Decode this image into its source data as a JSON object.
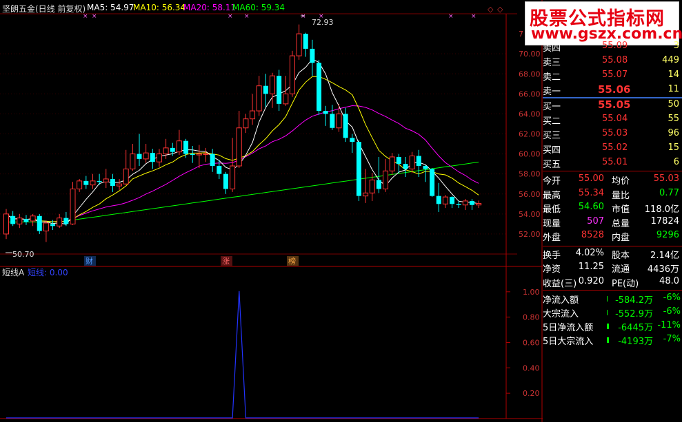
{
  "header": {
    "stock_title": "坚朗五金(日线 前复权)",
    "ma5_label": "MA5: 54.97",
    "ma10_label": "MA10: 56.34",
    "ma20_label": "MA20: 58.11",
    "ma60_label": "MA60: 59.34",
    "colors": {
      "ma5": "#ffffff",
      "ma10": "#ffff00",
      "ma20": "#ff00ff",
      "ma60": "#00ff00",
      "up": "#ff3333",
      "down": "#00ffff"
    }
  },
  "indicator": {
    "name": "短线A",
    "value_label": "短线: 0.00",
    "ticks": [
      "1.00",
      "0.80",
      "0.60",
      "0.40",
      "0.20"
    ]
  },
  "price_axis": [
    "70.00",
    "68.00",
    "66.00",
    "64.00",
    "62.00",
    "60.00",
    "58.00",
    "56.00",
    "54.00",
    "52.00"
  ],
  "price_axis_top": "7",
  "annotations": {
    "high_price": "72.93",
    "low_price": "50.70",
    "events": [
      "财",
      "涨",
      "榜"
    ]
  },
  "logo": {
    "main": "股票公式指标网",
    "url": "www.gszx.com.cn"
  },
  "orderbook": {
    "asks": [
      {
        "label": "卖四",
        "price": "55.09",
        "vol": "3"
      },
      {
        "label": "卖三",
        "price": "55.08",
        "vol": "449"
      },
      {
        "label": "卖二",
        "price": "55.07",
        "vol": "14"
      },
      {
        "label": "卖一",
        "price": "55.06",
        "vol": "11"
      }
    ],
    "bids": [
      {
        "label": "买一",
        "price": "55.05",
        "vol": "50"
      },
      {
        "label": "买二",
        "price": "55.04",
        "vol": "55"
      },
      {
        "label": "买三",
        "price": "55.03",
        "vol": "96"
      },
      {
        "label": "买四",
        "price": "55.02",
        "vol": "15"
      },
      {
        "label": "买五",
        "price": "55.01",
        "vol": "6"
      }
    ]
  },
  "quote": [
    {
      "l1": "今开",
      "v1": "55.00",
      "c1": "#ff3333",
      "l2": "均价",
      "v2": "55.03",
      "c2": "#ff3333"
    },
    {
      "l1": "最高",
      "v1": "55.34",
      "c1": "#ff3333",
      "l2": "量比",
      "v2": "0.77",
      "c2": "#00ff00"
    },
    {
      "l1": "最低",
      "v1": "54.60",
      "c1": "#00ff00",
      "l2": "市值",
      "v2": "118.0亿",
      "c2": "#ffffff"
    },
    {
      "l1": "现量",
      "v1": "507",
      "c1": "#ff33ff",
      "l2": "总量",
      "v2": "17824",
      "c2": "#ffffff"
    },
    {
      "l1": "外盘",
      "v1": "8528",
      "c1": "#ff3333",
      "l2": "内盘",
      "v2": "9296",
      "c2": "#00ff00"
    }
  ],
  "fundamentals": [
    {
      "l1": "换手",
      "v1": "4.02%",
      "l2": "股本",
      "v2": "2.14亿"
    },
    {
      "l1": "净资",
      "v1": "11.25",
      "l2": "流通",
      "v2": "4436万"
    },
    {
      "l1": "收益(三)",
      "v1": "0.920",
      "l2": "PE(动)",
      "v2": "48.0"
    }
  ],
  "flows": [
    {
      "label": "净流入额",
      "value": "-584.2万",
      "pct": "-6%"
    },
    {
      "label": "大宗流入",
      "value": "-552.9万",
      "pct": "-6%"
    },
    {
      "label": "5日净流入额",
      "value": "-6445万",
      "pct": "-11%"
    },
    {
      "label": "5日大宗流入",
      "value": "-4193万",
      "pct": "-7%"
    }
  ],
  "chart_data": {
    "type": "candlestick",
    "ylim": [
      50.0,
      74.0
    ],
    "candles": [
      [
        52.0,
        54.0,
        51.5,
        54.5
      ],
      [
        53.8,
        53.0,
        52.8,
        54.3
      ],
      [
        53.0,
        53.6,
        52.6,
        54.0
      ],
      [
        53.5,
        53.2,
        52.9,
        53.9
      ],
      [
        53.3,
        53.8,
        52.8,
        54.0
      ],
      [
        53.8,
        52.3,
        52.0,
        54.0
      ],
      [
        52.3,
        53.1,
        51.2,
        53.3
      ],
      [
        53.0,
        52.8,
        52.4,
        53.4
      ],
      [
        52.8,
        53.6,
        52.6,
        54.0
      ],
      [
        53.6,
        53.0,
        52.8,
        54.2
      ],
      [
        53.0,
        56.5,
        52.9,
        57.2
      ],
      [
        56.5,
        57.3,
        56.2,
        57.5
      ],
      [
        57.3,
        56.9,
        56.5,
        57.8
      ],
      [
        56.9,
        57.3,
        56.5,
        58.0
      ],
      [
        57.3,
        57.2,
        56.9,
        58.0
      ],
      [
        57.2,
        57.5,
        56.6,
        58.5
      ],
      [
        57.5,
        56.8,
        56.2,
        58.0
      ],
      [
        56.8,
        57.0,
        56.4,
        57.5
      ],
      [
        57.0,
        58.5,
        56.9,
        60.4
      ],
      [
        58.5,
        60.0,
        58.3,
        61.0
      ],
      [
        60.0,
        59.5,
        58.8,
        62.0
      ],
      [
        59.5,
        60.1,
        59.1,
        61.0
      ],
      [
        60.1,
        59.2,
        58.5,
        60.5
      ],
      [
        59.2,
        60.0,
        58.7,
        60.5
      ],
      [
        60.0,
        60.6,
        59.5,
        61.5
      ],
      [
        60.6,
        60.2,
        59.8,
        61.1
      ],
      [
        60.2,
        61.3,
        59.9,
        62.4
      ],
      [
        61.3,
        60.0,
        59.6,
        61.5
      ],
      [
        60.0,
        59.9,
        59.1,
        60.8
      ],
      [
        59.9,
        60.0,
        58.6,
        60.9
      ],
      [
        60.0,
        60.0,
        59.2,
        60.6
      ],
      [
        60.0,
        58.8,
        58.2,
        60.5
      ],
      [
        58.8,
        58.0,
        57.5,
        59.4
      ],
      [
        58.0,
        56.5,
        56.0,
        58.2
      ],
      [
        56.5,
        58.8,
        56.2,
        61.6
      ],
      [
        58.8,
        62.6,
        58.6,
        64.3
      ],
      [
        62.6,
        63.5,
        62.1,
        64.0
      ],
      [
        63.5,
        64.3,
        62.9,
        66.0
      ],
      [
        64.3,
        66.8,
        63.8,
        67.8
      ],
      [
        66.8,
        66.0,
        64.7,
        68.0
      ],
      [
        66.0,
        67.8,
        64.6,
        68.1
      ],
      [
        67.8,
        65.0,
        64.3,
        68.4
      ],
      [
        65.0,
        66.0,
        64.8,
        67.8
      ],
      [
        66.0,
        69.8,
        65.7,
        70.3
      ],
      [
        69.8,
        72.0,
        69.4,
        72.93
      ],
      [
        72.0,
        70.5,
        69.7,
        72.1
      ],
      [
        70.5,
        69.1,
        67.8,
        71.4
      ],
      [
        69.1,
        64.3,
        63.9,
        69.4
      ],
      [
        64.3,
        64.0,
        62.8,
        64.8
      ],
      [
        64.0,
        62.6,
        62.4,
        64.9
      ],
      [
        62.6,
        64.0,
        62.2,
        65.0
      ],
      [
        64.0,
        61.6,
        61.2,
        64.6
      ],
      [
        61.6,
        61.2,
        60.1,
        62.0
      ],
      [
        61.2,
        55.8,
        55.3,
        61.4
      ],
      [
        55.8,
        56.1,
        55.1,
        58.5
      ],
      [
        56.1,
        57.4,
        55.3,
        58.1
      ],
      [
        57.4,
        56.5,
        56.1,
        59.7
      ],
      [
        56.5,
        58.3,
        56.2,
        59.5
      ],
      [
        58.3,
        59.7,
        57.9,
        60.1
      ],
      [
        59.7,
        59.0,
        58.1,
        60.0
      ],
      [
        59.0,
        58.5,
        57.7,
        59.7
      ],
      [
        58.5,
        59.8,
        58.1,
        60.2
      ],
      [
        59.8,
        58.8,
        57.7,
        60.4
      ],
      [
        58.8,
        58.5,
        57.2,
        58.9
      ],
      [
        58.5,
        55.8,
        55.7,
        58.6
      ],
      [
        55.8,
        55.0,
        54.2,
        57.1
      ],
      [
        55.0,
        55.7,
        54.6,
        55.9
      ],
      [
        55.7,
        55.0,
        54.6,
        55.8
      ],
      [
        55.0,
        54.9,
        54.6,
        55.3
      ],
      [
        54.9,
        55.3,
        54.4,
        55.5
      ],
      [
        55.3,
        54.9,
        54.4,
        55.5
      ],
      [
        54.9,
        55.05,
        54.6,
        55.34
      ]
    ],
    "indicator_values": [
      0,
      0,
      0,
      0,
      0,
      0,
      0,
      0,
      0,
      0,
      0,
      0,
      0,
      0,
      0,
      0,
      0,
      0,
      0,
      0,
      0,
      0,
      0,
      0,
      0,
      0,
      0,
      0,
      0,
      0,
      0,
      0,
      0,
      0,
      0,
      0,
      0,
      0,
      0,
      0,
      0,
      0,
      0,
      0,
      0,
      0,
      0,
      0,
      0,
      0,
      0,
      0,
      0,
      0,
      0,
      0,
      0,
      0,
      0,
      0,
      0,
      0,
      0,
      0,
      0,
      0,
      0,
      0,
      0,
      0,
      0,
      0
    ],
    "indicator_spike": {
      "index": 35,
      "value": 1.0
    },
    "indicator_ylim": [
      0,
      1.2
    ]
  }
}
